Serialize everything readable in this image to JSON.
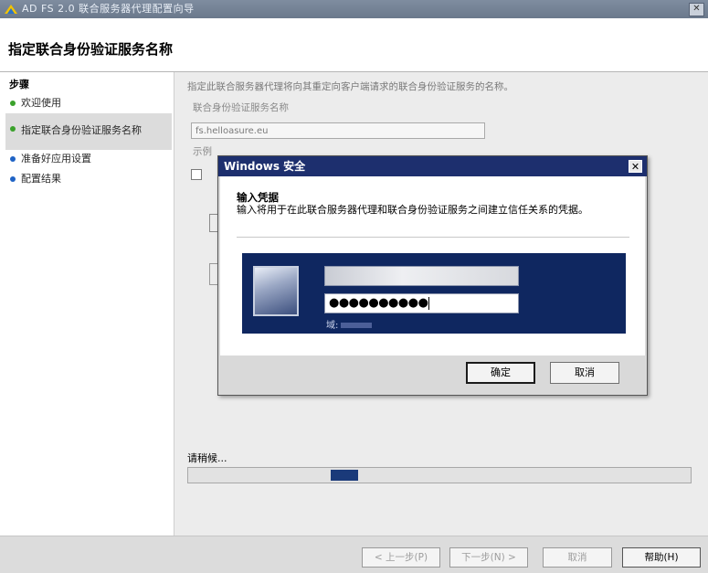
{
  "window": {
    "title": "AD FS 2.0 联合服务器代理配置向导",
    "close_glyph": "✕"
  },
  "header": {
    "title": "指定联合身份验证服务名称"
  },
  "steps": {
    "heading": "步骤",
    "items": [
      {
        "label": "欢迎使用",
        "status": "done",
        "color": "#3aa12b"
      },
      {
        "label": "指定联合身份验证服务名称",
        "status": "current",
        "color": "#3aa12b"
      },
      {
        "label": "准备好应用设置",
        "status": "pending",
        "color": "#1f63c5"
      },
      {
        "label": "配置结果",
        "status": "pending",
        "color": "#1f63c5"
      }
    ]
  },
  "main": {
    "description": "指定此联合服务器代理将向其重定向客户端请求的联合身份验证服务的名称。",
    "service_name_label": "联合身份验证服务名称",
    "service_name_value": "fs.helloasure.eu",
    "example_prefix": "示例",
    "progress_label": "请稍候...",
    "progress_value": 0.31
  },
  "footer": {
    "prev_label": "< 上一步(P)",
    "next_label": "下一步(N) >",
    "cancel_label": "取消",
    "help_label": "帮助(H)"
  },
  "dialog": {
    "title": "Windows 安全",
    "close_glyph": "✕",
    "heading": "输入凭据",
    "description": "输入将用于在此联合服务器代理和联合身份验证服务之间建立信任关系的凭据。",
    "password_mask": "●●●●●●●●●●",
    "domain_prefix": "域:",
    "ok_label": "确定",
    "cancel_label": "取消"
  },
  "colors": {
    "dialog_titlebar": "#1d2f6e",
    "credential_tile": "#0f2760",
    "progress_bar": "#1a3a7a"
  }
}
